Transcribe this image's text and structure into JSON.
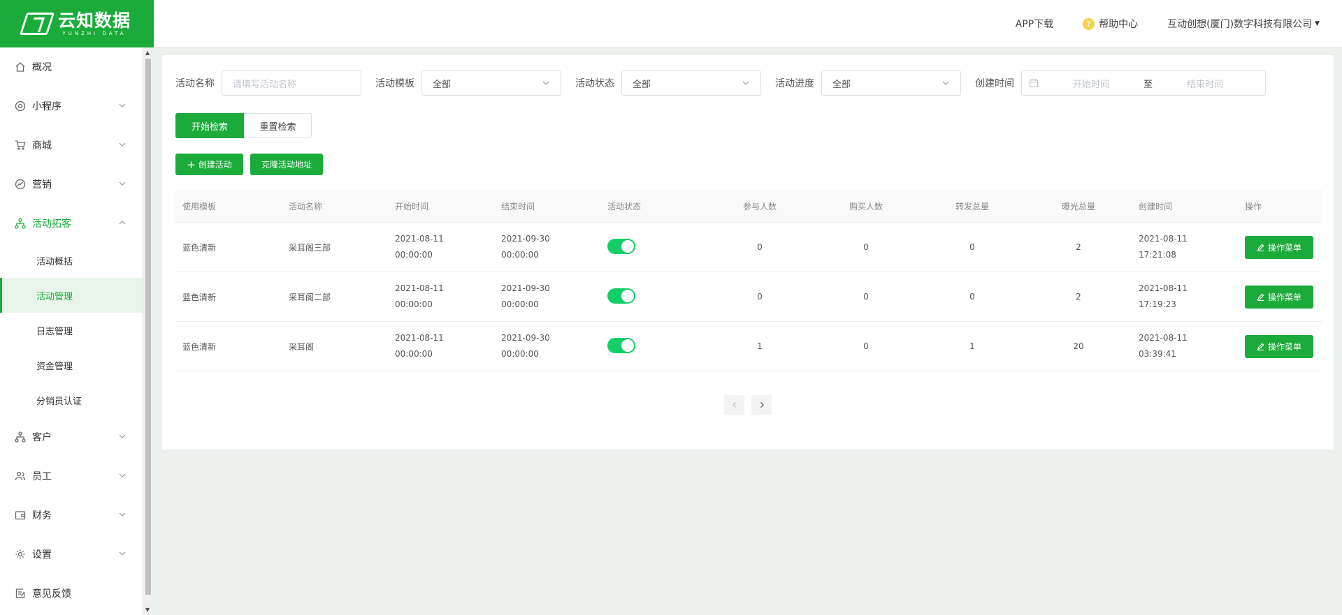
{
  "header": {
    "logo_cn": "云知数据",
    "logo_en": "YUNZHI DATA",
    "app_download": "APP下载",
    "help_center": "帮助中心",
    "company": "互动创想(厦门)数字科技有限公司",
    "accent_color": "#1aab3a"
  },
  "sidebar": {
    "items": [
      {
        "label": "概况",
        "icon": "home-icon"
      },
      {
        "label": "小程序",
        "icon": "miniprogram-icon"
      },
      {
        "label": "商城",
        "icon": "cart-icon"
      },
      {
        "label": "营销",
        "icon": "marketing-icon"
      },
      {
        "label": "活动拓客",
        "icon": "network-icon"
      },
      {
        "label": "客户",
        "icon": "customer-icon"
      },
      {
        "label": "员工",
        "icon": "staff-icon"
      },
      {
        "label": "财务",
        "icon": "wallet-icon"
      },
      {
        "label": "设置",
        "icon": "gear-icon"
      },
      {
        "label": "意见反馈",
        "icon": "feedback-icon"
      }
    ],
    "subitems": [
      {
        "label": "活动概括"
      },
      {
        "label": "活动管理"
      },
      {
        "label": "日志管理"
      },
      {
        "label": "资金管理"
      },
      {
        "label": "分销员认证"
      }
    ]
  },
  "filters": {
    "name_label": "活动名称",
    "name_placeholder": "请填写活动名称",
    "template_label": "活动模板",
    "template_value": "全部",
    "status_label": "活动状态",
    "status_value": "全部",
    "progress_label": "活动进度",
    "progress_value": "全部",
    "created_label": "创建时间",
    "start_placeholder": "开始时间",
    "to": "至",
    "end_placeholder": "结束时间"
  },
  "actions": {
    "search": "开始检索",
    "reset": "重置检索",
    "create": "创建活动",
    "clone": "克隆活动地址"
  },
  "table": {
    "headers": [
      "使用模板",
      "活动名称",
      "开始时间",
      "结束时间",
      "活动状态",
      "参与人数",
      "购买人数",
      "转发总量",
      "曝光总量",
      "创建时间",
      "操作"
    ],
    "rows": [
      {
        "template": "蓝色清新",
        "name": "采耳阁三部",
        "start_date": "2021-08-11",
        "start_time": "00:00:00",
        "end_date": "2021-09-30",
        "end_time": "00:00:00",
        "status_on": true,
        "participants": "0",
        "buyers": "0",
        "shares": "0",
        "exposure": "2",
        "created_date": "2021-08-11",
        "created_time": "17:21:08",
        "op": "操作菜单"
      },
      {
        "template": "蓝色清新",
        "name": "采耳阁二部",
        "start_date": "2021-08-11",
        "start_time": "00:00:00",
        "end_date": "2021-09-30",
        "end_time": "00:00:00",
        "status_on": true,
        "participants": "0",
        "buyers": "0",
        "shares": "0",
        "exposure": "2",
        "created_date": "2021-08-11",
        "created_time": "17:19:23",
        "op": "操作菜单"
      },
      {
        "template": "蓝色清新",
        "name": "采耳阁",
        "start_date": "2021-08-11",
        "start_time": "00:00:00",
        "end_date": "2021-09-30",
        "end_time": "00:00:00",
        "status_on": true,
        "participants": "1",
        "buyers": "0",
        "shares": "1",
        "exposure": "20",
        "created_date": "2021-08-11",
        "created_time": "03:39:41",
        "op": "操作菜单"
      }
    ]
  }
}
